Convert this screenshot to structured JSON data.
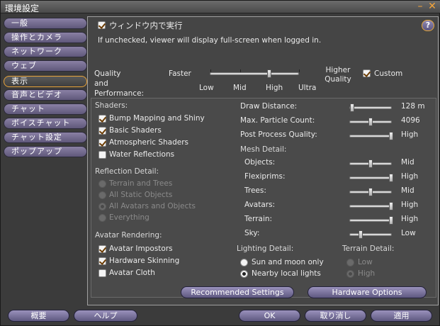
{
  "window": {
    "title": "環境設定"
  },
  "sidebar": {
    "items": [
      {
        "label": "一般"
      },
      {
        "label": "操作とカメラ"
      },
      {
        "label": "ネットワーク"
      },
      {
        "label": "ウェブ"
      },
      {
        "label": "表示"
      },
      {
        "label": "音声とビデオ"
      },
      {
        "label": "チャット"
      },
      {
        "label": "ボイスチャット"
      },
      {
        "label": "チャット設定"
      },
      {
        "label": "ポップアップ"
      }
    ],
    "selected_index": 4
  },
  "top": {
    "windowed_label": "ウィンドウ内で実行",
    "windowed_checked": true,
    "hint": "If unchecked, viewer will display full-screen when logged in.",
    "help": "?"
  },
  "quality": {
    "label": "Quality and Performance:",
    "faster": "Faster",
    "higher": "Higher Quality",
    "ticks": [
      "Low",
      "Mid",
      "High",
      "Ultra"
    ],
    "value_index": 2,
    "custom_label": "Custom",
    "custom_checked": true
  },
  "shaders": {
    "heading": "Shaders:",
    "items": [
      {
        "label": "Bump Mapping and Shiny",
        "checked": true
      },
      {
        "label": "Basic Shaders",
        "checked": true
      },
      {
        "label": "Atmospheric Shaders",
        "checked": true
      },
      {
        "label": "Water Reflections",
        "checked": false
      }
    ]
  },
  "reflection": {
    "heading": "Reflection Detail:",
    "options": [
      "Terrain and Trees",
      "All Static Objects",
      "All Avatars and Objects",
      "Everything"
    ],
    "selected_index": 2
  },
  "avatar_rendering": {
    "heading": "Avatar Rendering:",
    "items": [
      {
        "label": "Avatar Impostors",
        "checked": true
      },
      {
        "label": "Hardware Skinning",
        "checked": true
      },
      {
        "label": "Avatar Cloth",
        "checked": false
      }
    ]
  },
  "sliders": {
    "draw_distance": {
      "label": "Draw Distance:",
      "value": "128 m",
      "fraction": 0.05
    },
    "particle_count": {
      "label": "Max. Particle Count:",
      "value": "4096",
      "fraction": 0.5
    },
    "post_process": {
      "label": "Post Process Quality:",
      "value": "High",
      "fraction": 1.0
    }
  },
  "mesh": {
    "heading": "Mesh Detail:",
    "items": [
      {
        "label": "Objects:",
        "value": "Mid",
        "fraction": 0.5
      },
      {
        "label": "Flexiprims:",
        "value": "High",
        "fraction": 1.0
      },
      {
        "label": "Trees:",
        "value": "Mid",
        "fraction": 0.5
      },
      {
        "label": "Avatars:",
        "value": "High",
        "fraction": 1.0
      },
      {
        "label": "Terrain:",
        "value": "High",
        "fraction": 1.0
      },
      {
        "label": "Sky:",
        "value": "Low",
        "fraction": 0.25
      }
    ]
  },
  "lighting": {
    "heading": "Lighting Detail:",
    "options": [
      "Sun and moon only",
      "Nearby local lights"
    ],
    "selected_index": 1
  },
  "terrain": {
    "heading": "Terrain Detail:",
    "options": [
      "Low",
      "High"
    ],
    "selected_index": 1
  },
  "buttons": {
    "recommended": "Recommended Settings",
    "hardware": "Hardware Options",
    "about": "概要",
    "help": "ヘルプ",
    "ok": "OK",
    "cancel": "取り消し",
    "apply": "適用"
  }
}
